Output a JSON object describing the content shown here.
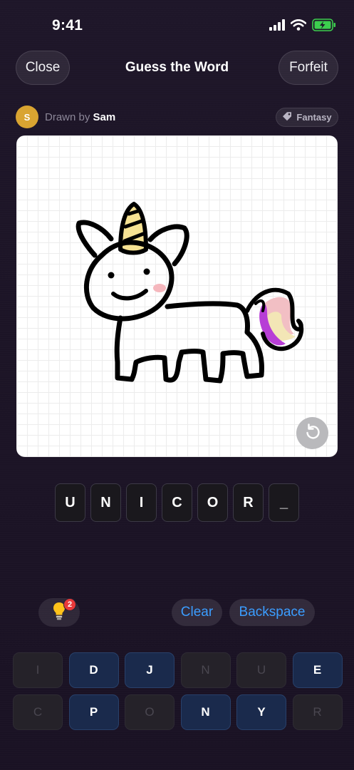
{
  "status": {
    "time": "9:41"
  },
  "header": {
    "close_label": "Close",
    "title": "Guess the Word",
    "forfeit_label": "Forfeit"
  },
  "drawer": {
    "avatar_initial": "S",
    "drawn_by_prefix": "Drawn by",
    "name": "Sam",
    "category": "Fantasy"
  },
  "canvas": {
    "background": "#ffffff",
    "drawing_subject_icon": "unicorn-drawing"
  },
  "answer": {
    "slots": [
      "U",
      "N",
      "I",
      "C",
      "O",
      "R",
      "_"
    ]
  },
  "actions": {
    "hint_count": "2",
    "clear_label": "Clear",
    "backspace_label": "Backspace"
  },
  "keyboard": {
    "keys": [
      {
        "letter": "I",
        "used": true
      },
      {
        "letter": "D",
        "used": false
      },
      {
        "letter": "J",
        "used": false
      },
      {
        "letter": "N",
        "used": true
      },
      {
        "letter": "U",
        "used": true
      },
      {
        "letter": "E",
        "used": false
      },
      {
        "letter": "C",
        "used": true
      },
      {
        "letter": "P",
        "used": false
      },
      {
        "letter": "O",
        "used": true
      },
      {
        "letter": "N",
        "used": false
      },
      {
        "letter": "Y",
        "used": false
      },
      {
        "letter": "R",
        "used": true
      }
    ]
  },
  "colors": {
    "background": "#1d1528",
    "accent": "#3b9dff",
    "avatar": "#d9a431",
    "badge": "#e8393a",
    "key_available": "#1a2a4c",
    "key_used": "#252229"
  }
}
